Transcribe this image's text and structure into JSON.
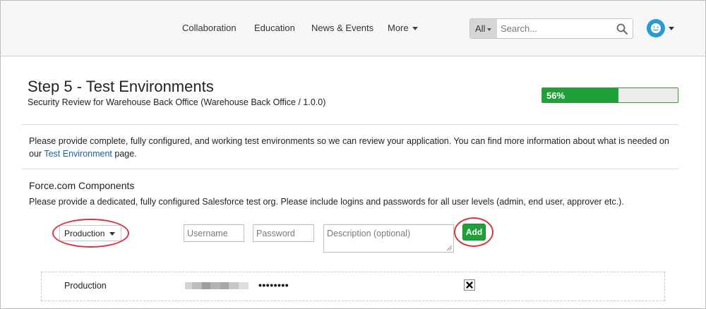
{
  "nav": {
    "items": [
      {
        "label": "Collaboration"
      },
      {
        "label": "Education"
      },
      {
        "label": "News & Events"
      },
      {
        "label": "More"
      }
    ]
  },
  "search": {
    "scope": "All",
    "placeholder": "Search..."
  },
  "page": {
    "title": "Step 5 - Test Environments",
    "subtitle": "Security Review for Warehouse Back Office (Warehouse Back Office / 1.0.0)",
    "progress_label": "56%",
    "progress_value": 56
  },
  "intro": {
    "text_before": "Please provide complete, fully configured, and working test environments so we can review your application. You can find more information about what is needed on our ",
    "link_text": "Test Environment",
    "text_after": " page."
  },
  "section": {
    "title": "Force.com Components",
    "description": "Please provide a dedicated, fully configured Salesforce test org. Please include logins and passwords for all user levels (admin, end user, approver etc.)."
  },
  "form": {
    "environment_selected": "Production",
    "username_placeholder": "Username",
    "password_placeholder": "Password",
    "description_placeholder": "Description (optional)",
    "add_label": "Add"
  },
  "entries": [
    {
      "environment": "Production",
      "password_masked": "••••••••"
    }
  ],
  "colors": {
    "accent_green": "#1ea13a",
    "link_blue": "#1b5fa8",
    "highlight_red": "#d9363e",
    "avatar_blue": "#2a9ad6"
  },
  "icons": {
    "search": "search-icon",
    "avatar": "user-avatar-icon",
    "dropdown": "chevron-down-icon",
    "delete": "close-icon"
  }
}
